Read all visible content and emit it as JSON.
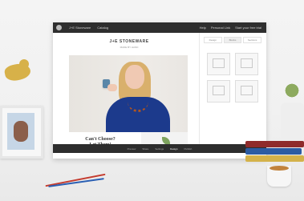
{
  "app": {
    "brand": "J+E STONEWARE",
    "brand_sub": "MADE BY HAND",
    "cta": "Can't Choose?\nLet Them!"
  },
  "topbar": {
    "nav": [
      "J+E Stoneware",
      "Catalog"
    ],
    "right": [
      "Help",
      "Personal Link",
      "Start your free trial"
    ]
  },
  "panel": {
    "tabs": [
      "Design",
      "Blocks",
      "Sections"
    ]
  },
  "bottombar": {
    "items": [
      "Preview",
      "Share",
      "Settings",
      "Design",
      "Publish"
    ],
    "active_index": 3
  },
  "colors": {
    "topbar": "#2e2e2e",
    "bottombar": "#2d2d2d",
    "shirt": "#1c3a8c",
    "hair": "#d9b06c"
  }
}
